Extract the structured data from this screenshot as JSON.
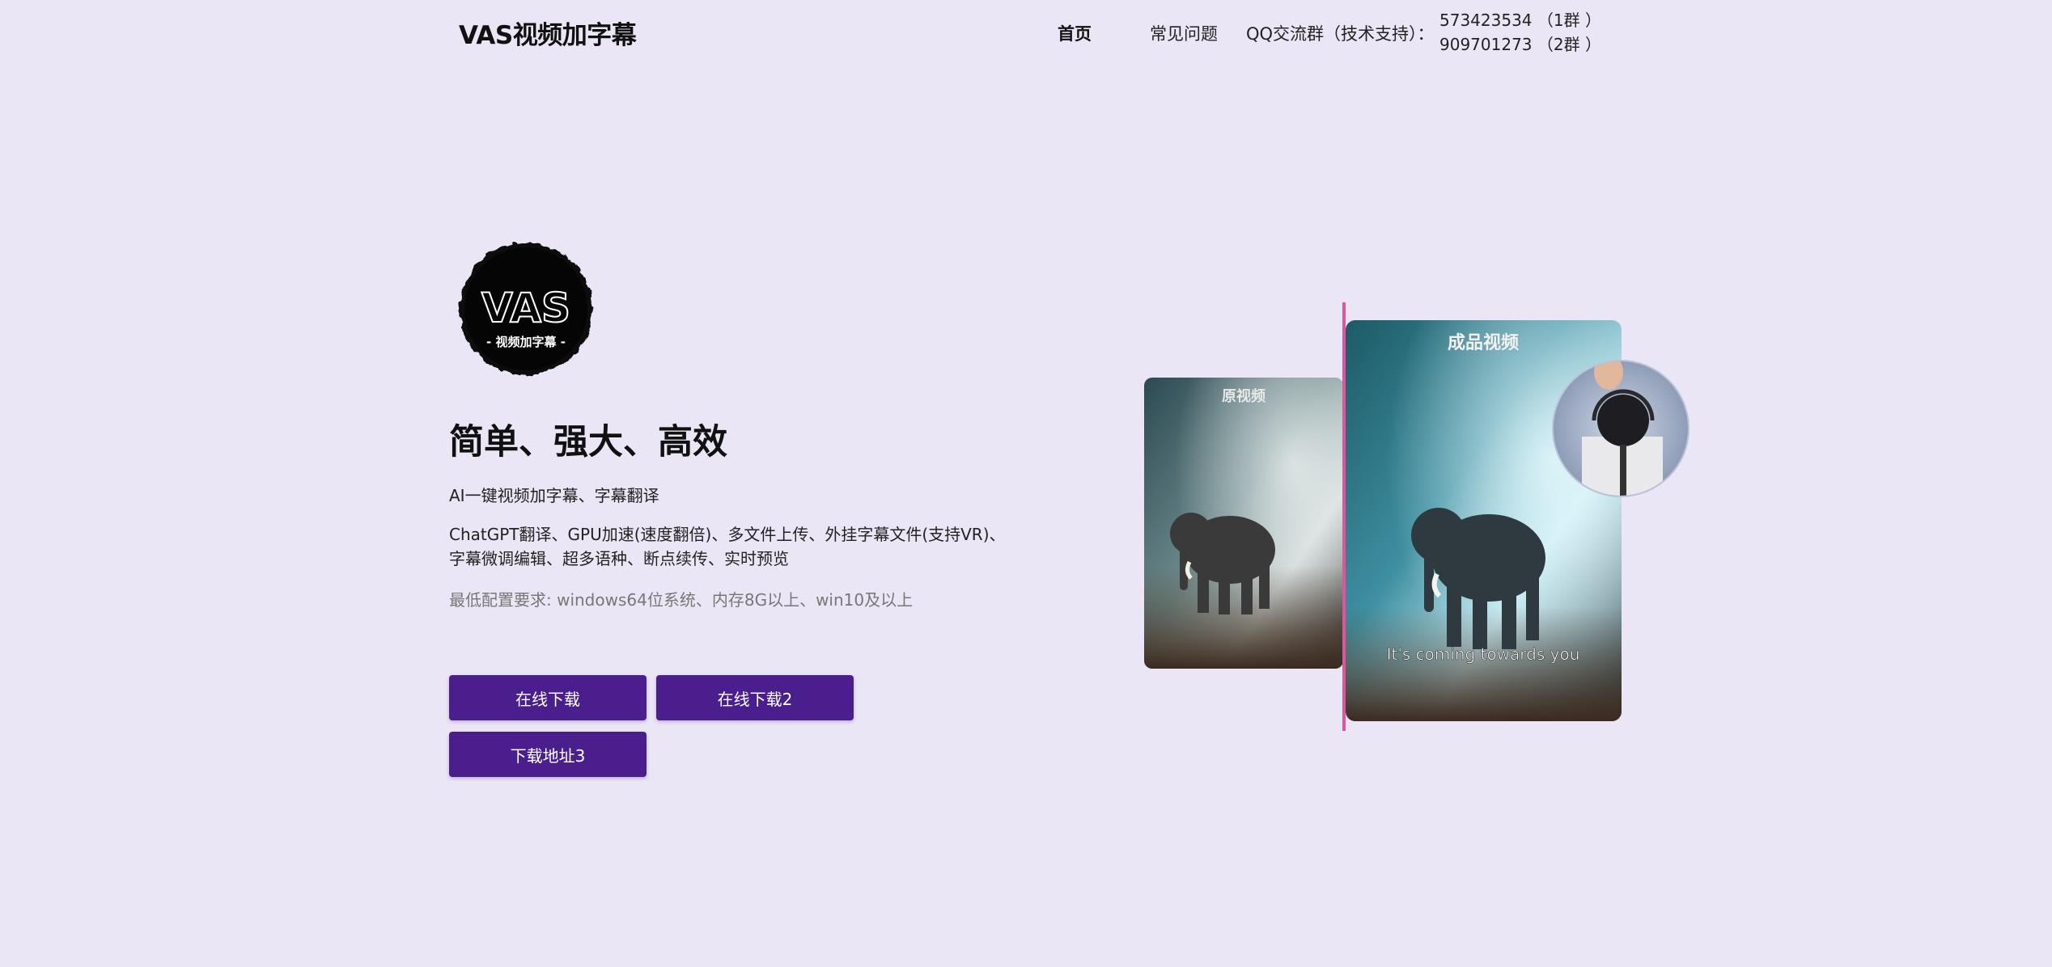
{
  "header": {
    "site_title": "VAS视频加字幕",
    "nav": {
      "home": "首页",
      "faq": "常见问题",
      "qq_label": "QQ交流群（技术支持）：",
      "qq_group_1": "573423534 （1群 ）",
      "qq_group_2": "909701273 （2群 ）"
    }
  },
  "logo": {
    "title": "VAS",
    "subtitle": "- 视频加字幕 -"
  },
  "hero": {
    "headline": "简单、强大、高效",
    "line1": "AI一键视频加字幕、字幕翻译",
    "line2": "ChatGPT翻译、GPU加速(速度翻倍)、多文件上传、外挂字幕文件(支持VR)、字幕微调编辑、超多语种、断点续传、实时预览",
    "line3": "最低配置要求: windows64位系统、内存8G以上、win10及以上"
  },
  "buttons": {
    "download1": "在线下载",
    "download2": "在线下载2",
    "download3": "下载地址3"
  },
  "preview": {
    "original_label": "原视频",
    "result_label": "成品视频",
    "subtitle_caption": "It's coming towards you"
  },
  "colors": {
    "background": "#ebe6f5",
    "button": "#4b1e8e",
    "divider": "#e0559a"
  }
}
